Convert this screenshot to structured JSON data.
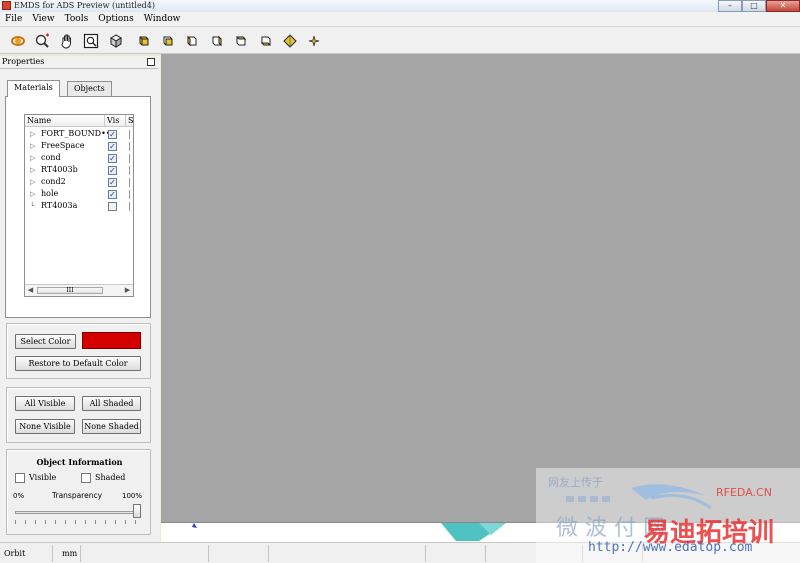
{
  "window": {
    "title": "EMDS for ADS Preview (untitled4)",
    "controls": [
      "–",
      "□",
      "✕"
    ]
  },
  "menu": [
    "File",
    "View",
    "Tools",
    "Options",
    "Window"
  ],
  "toolbar": {
    "tools": [
      "orbit-icon",
      "zoom-icon",
      "pan-icon",
      "zoom-fit-icon",
      "view-3d-icon",
      "view-front-icon",
      "view-back-icon",
      "view-left-icon",
      "view-right-icon",
      "view-top-icon",
      "view-bottom-icon",
      "view-iso-icon",
      "sparkle-icon"
    ]
  },
  "properties": {
    "title": "Properties",
    "tabs": [
      "Materials",
      "Objects"
    ],
    "active_tab": "Materials",
    "tree": {
      "columns": [
        "Name",
        "Vis",
        "S"
      ],
      "rows": [
        {
          "name": "FORT_BOUND•••",
          "expandable": true,
          "visible": true
        },
        {
          "name": "FreeSpace",
          "expandable": true,
          "visible": true
        },
        {
          "name": "cond",
          "expandable": true,
          "visible": true
        },
        {
          "name": "RT4003b",
          "expandable": true,
          "visible": true
        },
        {
          "name": "cond2",
          "expandable": true,
          "visible": true
        },
        {
          "name": "hole",
          "expandable": true,
          "visible": true
        },
        {
          "name": "RT4003a",
          "expandable": false,
          "visible": false
        }
      ],
      "scroll_thumb": "III"
    },
    "color": {
      "select_label": "Select Color",
      "restore_label": "Restore to Default Color",
      "swatch": "#d40000"
    },
    "visibility": {
      "all_visible": "All Visible",
      "all_shaded": "All Shaded",
      "none_visible": "None Visible",
      "none_shaded": "None Shaded"
    },
    "object_info": {
      "title": "Object Information",
      "visible_label": "Visible",
      "shaded_label": "Shaded",
      "visible_checked": false,
      "shaded_checked": false,
      "min_label": "0%",
      "transparency_label": "Transparency",
      "max_label": "100%",
      "transparency_value": 1.0
    }
  },
  "status": {
    "mode": "Orbit",
    "units": "mm"
  },
  "watermark": {
    "line1": "网友上传于",
    "brand": "RFEDA.CN",
    "line2": "微 波 付 网",
    "line3": "易迪拓培训",
    "url": "http://www.edatop.com"
  }
}
